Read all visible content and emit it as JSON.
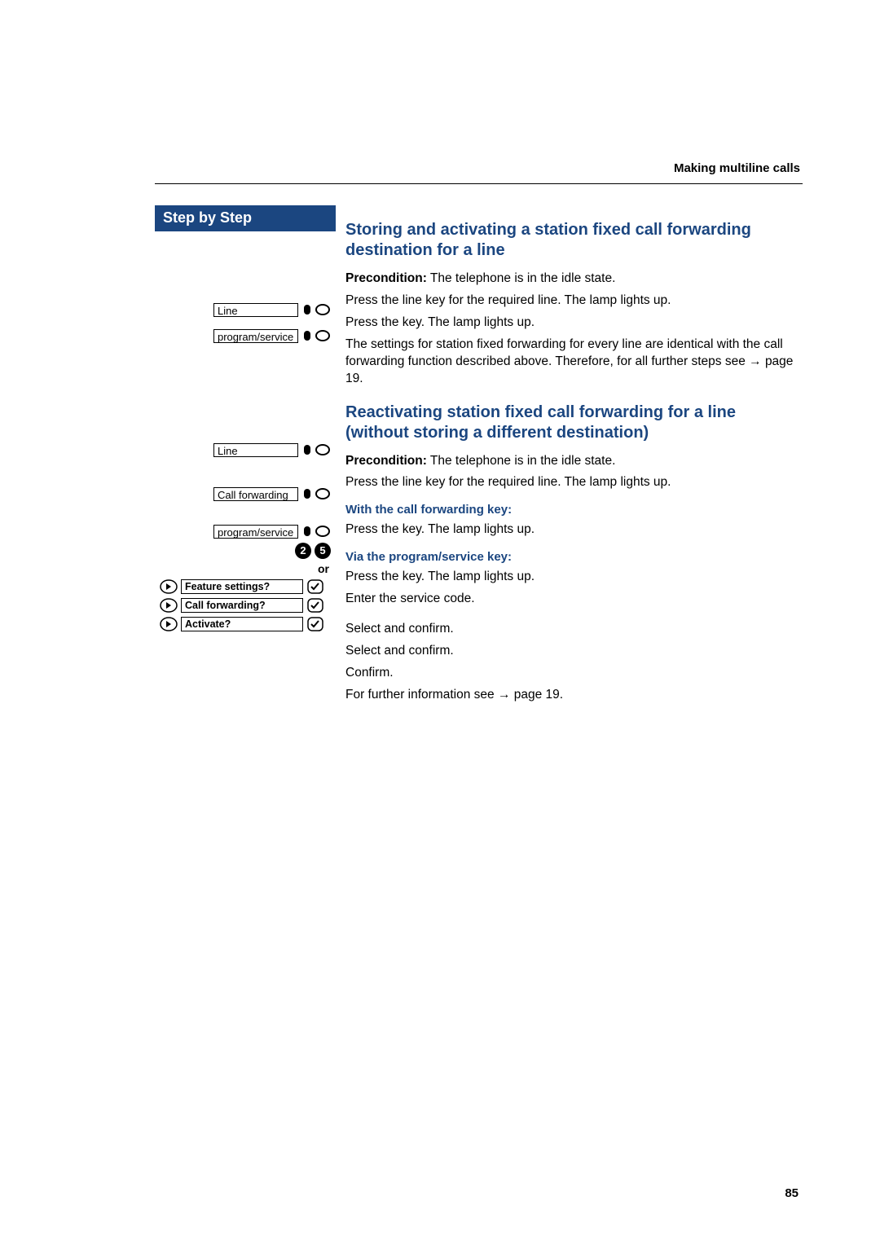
{
  "header": {
    "section_title": "Making multiline calls"
  },
  "sidebar": {
    "title": "Step by Step",
    "keys": {
      "line": "Line",
      "program_service": "program/service",
      "call_forwarding": "Call forwarding"
    },
    "digits": [
      "2",
      "5"
    ],
    "or": "or",
    "menu": {
      "feature_settings": "Feature settings?",
      "call_forwarding": "Call forwarding?",
      "activate": "Activate?"
    }
  },
  "content": {
    "h_storing": "Storing and activating a station fixed call forwarding destination for a line",
    "precond_label": "Precondition:",
    "precond_text": " The telephone is in the idle state.",
    "press_line_key": "Press the line key for the required line. The lamp lights up.",
    "press_key": "Press the key. The lamp lights up.",
    "settings_identical": "The settings for station fixed forwarding for every line are identical with the call forwarding function described above. Therefore, for all further steps see ",
    "page19a": "page 19.",
    "h_reactivate": "Reactivating station fixed call forwarding for a line (without storing a different destination)",
    "h_with_cf_key": "With the call forwarding key:",
    "h_via_ps_key": "Via the program/service key:",
    "enter_service_code": "Enter the service code.",
    "select_confirm": "Select and confirm.",
    "confirm": "Confirm.",
    "further_info": "For further information see ",
    "page19b": "page 19."
  },
  "footer": {
    "page": "85"
  }
}
